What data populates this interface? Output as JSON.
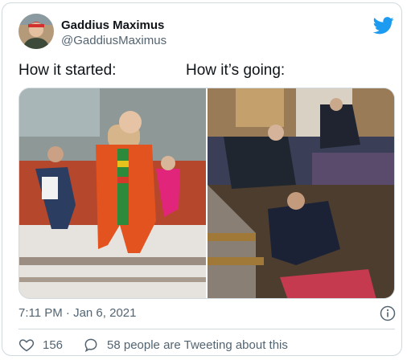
{
  "tweet": {
    "display_name": "Gaddius Maximus",
    "handle": "@GaddiusMaximus",
    "caption_left": "How it started:",
    "caption_right": "How it’s going:",
    "timestamp": "7:11 PM · Jan 6, 2021",
    "like_count": "156",
    "conversation_text": "58 people are Tweeting about this"
  },
  "colors": {
    "twitter_blue": "#1d9bf0",
    "secondary_text": "#536471",
    "primary_text": "#0f1419",
    "border": "#cfd9de"
  },
  "icons": {
    "logo": "twitter-bird-icon",
    "info": "info-icon",
    "like": "heart-icon",
    "reply": "speech-bubble-icon"
  }
}
